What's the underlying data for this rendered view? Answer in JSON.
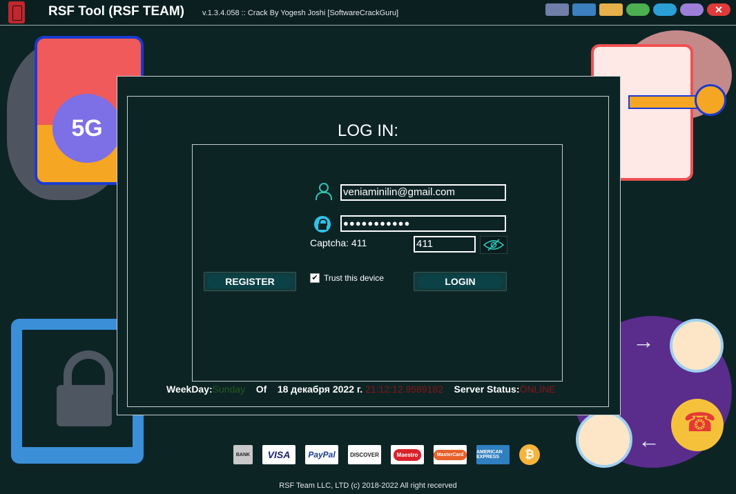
{
  "window": {
    "title": "RSF Tool (RSF TEAM)",
    "version": "v.1.3.4.058 :: Crack By Yogesh Joshi [SoftwareCrackGuru]",
    "toolbar_icons": [
      "network-icon",
      "team-icon",
      "folder-icon",
      "whatsapp-icon",
      "telegram-icon",
      "minimize-icon",
      "close-icon"
    ],
    "close_glyph": "✕"
  },
  "decor": {
    "five_g_label": "5G"
  },
  "login": {
    "title": "LOG IN:",
    "email": "veniaminilin@gmail.com",
    "password_mask": "●●●●●●●●●●●",
    "captcha_label": "Captcha: 411",
    "captcha_value": "411",
    "trust_label": "Trust this device",
    "trust_checked": true,
    "check_glyph": "✔",
    "register_label": "REGISTER",
    "login_label": "LOGIN"
  },
  "status": {
    "weekday_label": "WeekDay:",
    "weekday_value": "Sunday",
    "of_label": "Of",
    "date": "18 декабря 2022 г.",
    "time": "21:12:12.9589182",
    "server_label": "Server Status:",
    "server_value": "ONLINE"
  },
  "payments": {
    "bank": "BANK",
    "visa": "VISA",
    "paypal": "PayPal",
    "discover": "DISCOVER",
    "maestro": "Maestro",
    "mastercard": "MasterCard",
    "amex": "AMERICAN EXPRESS",
    "bitcoin": "₿"
  },
  "footer": "RSF Team LLC, LTD (c) 2018-2022 All right recerved",
  "colors": {
    "background": "#0d2425",
    "accent": "#2ec4b6",
    "weekday": "#1e5d1e",
    "time": "#8b1414"
  }
}
